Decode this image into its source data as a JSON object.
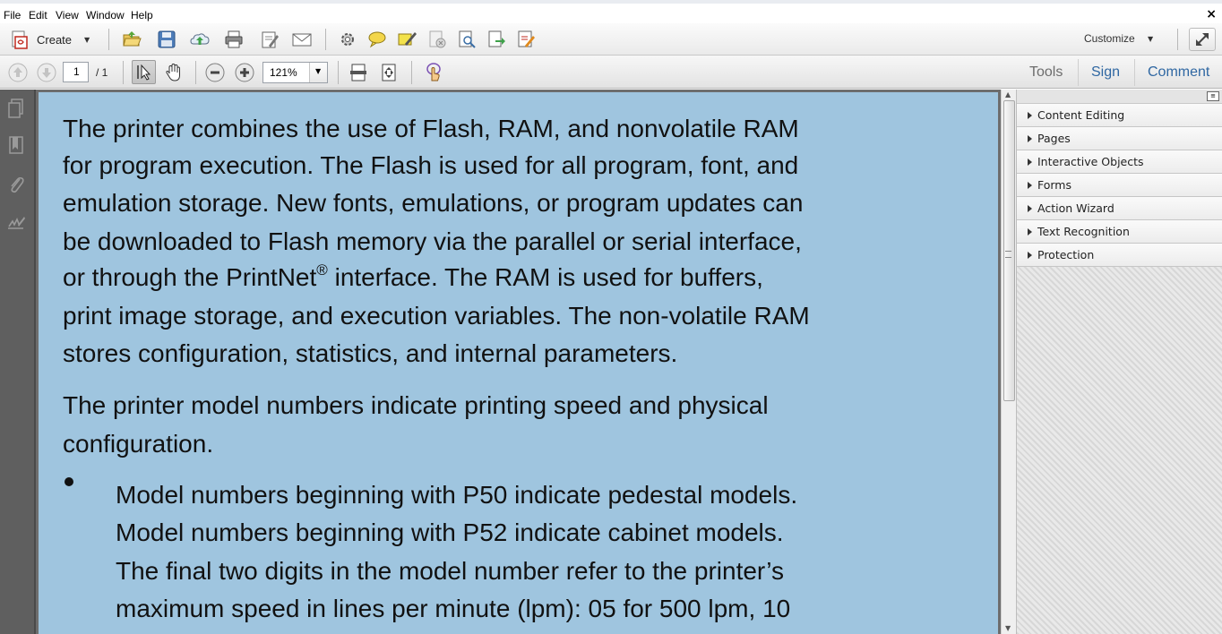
{
  "menubar": {
    "items": [
      "File",
      "Edit",
      "View",
      "Window",
      "Help"
    ],
    "close_glyph": "×"
  },
  "toolbar": {
    "create_label": "Create",
    "customize_label": "Customize",
    "icons": [
      "open-folder-icon",
      "save-icon",
      "upload-cloud-icon",
      "print-icon",
      "edit-document-icon",
      "email-icon",
      "settings-gear-icon",
      "comment-bubble-icon",
      "highlight-pen-icon",
      "redact-page-icon",
      "find-document-icon",
      "export-page-icon",
      "fill-sign-icon"
    ]
  },
  "navbar": {
    "current_page": "1",
    "total_pages": "/  1",
    "zoom": "121%",
    "tabs": {
      "tools": "Tools",
      "sign": "Sign",
      "comment": "Comment"
    }
  },
  "document": {
    "para1_lines": [
      "The printer combines the use of Flash, RAM, and nonvolatile RAM",
      "for program execution. The Flash is used for all program, font, and",
      "emulation storage. New fonts, emulations, or program updates can",
      "be downloaded to Flash memory via the parallel or serial interface,",
      "or through the PrintNet",
      "interface. The RAM is used for buffers,",
      "print image storage, and execution variables. The non-volatile RAM",
      "stores configuration, statistics, and internal parameters."
    ],
    "registered_mark": "®",
    "para2_lines": [
      "The printer model numbers indicate printing speed and physical",
      "configuration."
    ],
    "bullet_lines": [
      "Model numbers beginning with P50 indicate pedestal models.",
      "Model numbers beginning with P52 indicate cabinet models.",
      "The final two digits in the model number refer to the printer’s",
      "maximum speed in lines per minute (lpm): 05 for 500 lpm, 10"
    ]
  },
  "tools_panel": {
    "sections": [
      "Content Editing",
      "Pages",
      "Interactive Objects",
      "Forms",
      "Action Wizard",
      "Text Recognition",
      "Protection"
    ]
  },
  "colors": {
    "page_background": "#9fc5df",
    "sign_comment_link": "#2f67a2",
    "left_nav": "#5f5f5f"
  }
}
